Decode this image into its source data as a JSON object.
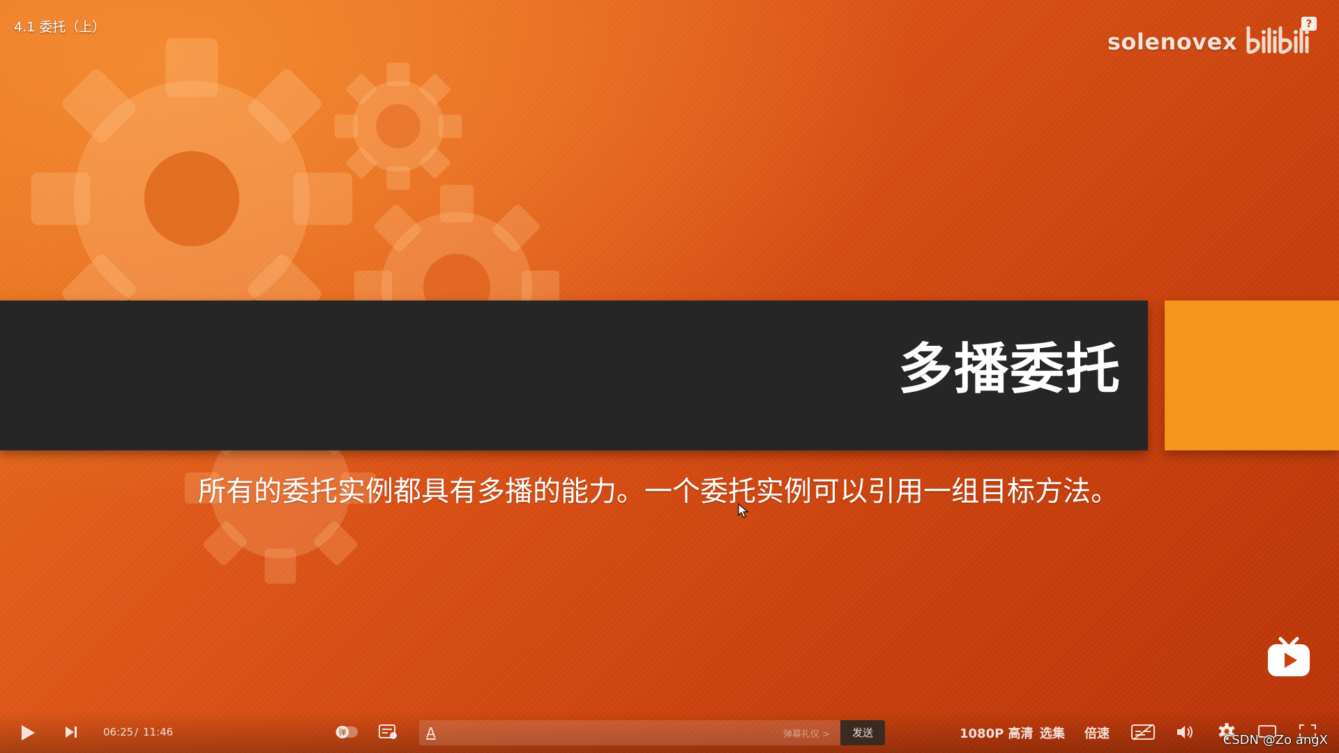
{
  "video": {
    "title": "4.1 委托（上）",
    "channel_name": "solenovex",
    "logo_text": "bilibili",
    "help_label": "?"
  },
  "slide": {
    "title": "多播委托",
    "body": "所有的委托实例都具有多播的能力。一个委托实例可以引用一组目标方法。"
  },
  "controls": {
    "time_current": "06:25",
    "time_separator": "/",
    "time_total": "11:46",
    "danmaku_toggle_label": "弹",
    "danmaku_placeholder": "",
    "danmaku_etiquette": "弹幕礼仪 >",
    "send_label": "发送",
    "quality_label": "1080P 高清",
    "episodes_label": "选集",
    "speed_label": "倍速"
  },
  "icons": {
    "play": "play-icon",
    "next": "next-icon",
    "danmaku_settings": "danmaku-settings-icon",
    "subtitle": "subtitle-off-icon",
    "volume": "volume-icon",
    "settings": "gear-icon",
    "widescreen": "widescreen-icon",
    "fullscreen": "fullscreen-icon",
    "mini_tv": "bilibili-tv-icon"
  },
  "watermark": "CSDN @Zo angX",
  "colors": {
    "background_start": "#e8731f",
    "background_end": "#b93308",
    "title_band": "#262626",
    "accent_block": "#f7941d"
  }
}
